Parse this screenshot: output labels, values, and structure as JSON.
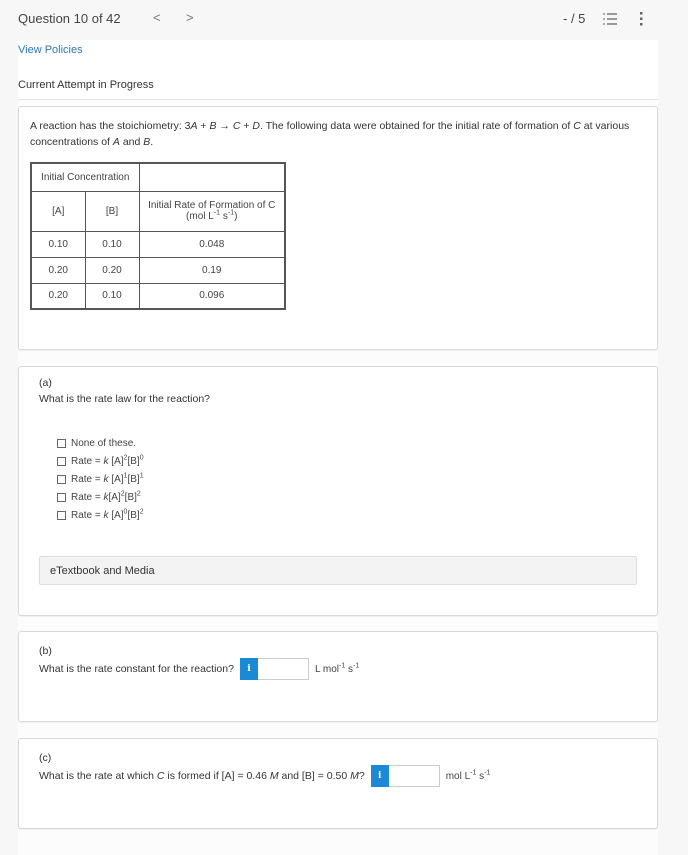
{
  "topbar": {
    "question_counter": "Question 10 of 42",
    "prev_icon": "chevron-left-icon",
    "prev_glyph": "<",
    "next_icon": "chevron-right-icon",
    "next_glyph": ">",
    "score": "- / 5",
    "list_icon": "list-icon",
    "more_icon": "more-vertical-icon"
  },
  "header": {
    "view_policies": "View Policies",
    "attempt_status": "Current Attempt in Progress"
  },
  "problem": {
    "text_part1": "A reaction has the stoichiometry: 3",
    "text_A": "A",
    "text_plus1": " + ",
    "text_B": "B",
    "text_arrow": " → ",
    "text_C": "C",
    "text_plus2": " + ",
    "text_D": "D",
    "text_part2": ". The following data were obtained for the initial rate of formation of ",
    "text_C2": "C",
    "text_part3": " at various concentrations of ",
    "text_A2": "A",
    "text_and": " and ",
    "text_B2": "B",
    "text_end": ".",
    "table": {
      "group_header": "Initial Concentration",
      "col_a": "[A]",
      "col_b": "[B]",
      "col_rate_line1": "Initial Rate of Formation of C",
      "col_rate_unit_pre": "(mol L",
      "col_rate_exp1": "-1",
      "col_rate_s": " s",
      "col_rate_exp2": "-1",
      "col_rate_close": ")",
      "rows": [
        {
          "a": "0.10",
          "b": "0.10",
          "rate": "0.048"
        },
        {
          "a": "0.20",
          "b": "0.20",
          "rate": "0.19"
        },
        {
          "a": "0.20",
          "b": "0.10",
          "rate": "0.096"
        }
      ]
    }
  },
  "part_a": {
    "label": "(a)",
    "question": "What is the rate law for the reaction?",
    "options": [
      {
        "text": "None of these.",
        "checked": false
      },
      {
        "prefix": "Rate = ",
        "k": "k",
        "a": " [A]",
        "ea": "2",
        "b": "[B]",
        "eb": "0",
        "checked": false
      },
      {
        "prefix": "Rate = ",
        "k": "k",
        "a": " [A]",
        "ea": "1",
        "b": "[B]",
        "eb": "1",
        "checked": false
      },
      {
        "prefix": "Rate = ",
        "k": "k",
        "a": "[A]",
        "ea": "2",
        "b": "[B]",
        "eb": "2",
        "checked": false
      },
      {
        "prefix": "Rate = ",
        "k": "k",
        "a": " [A]",
        "ea": "0",
        "b": "[B]",
        "eb": "2",
        "checked": false
      }
    ],
    "etextbook": "eTextbook and Media"
  },
  "part_b": {
    "label": "(b)",
    "question": "What is the rate constant for the reaction?",
    "info_glyph": "i",
    "input_value": "",
    "unit_pre": "L mol",
    "unit_exp1": "-1",
    "unit_s": " s",
    "unit_exp2": "-1"
  },
  "part_c": {
    "label": "(c)",
    "question_pre": "What is the rate at which ",
    "question_C": "C",
    "question_mid": " is formed if [A] = 0.46 ",
    "question_M1": "M",
    "question_mid2": " and [B] = 0.50 ",
    "question_M2": "M",
    "question_end": "?",
    "info_glyph": "i",
    "input_value": "",
    "unit_pre": "mol L",
    "unit_exp1": "-1",
    "unit_s": " s",
    "unit_exp2": "-1"
  }
}
